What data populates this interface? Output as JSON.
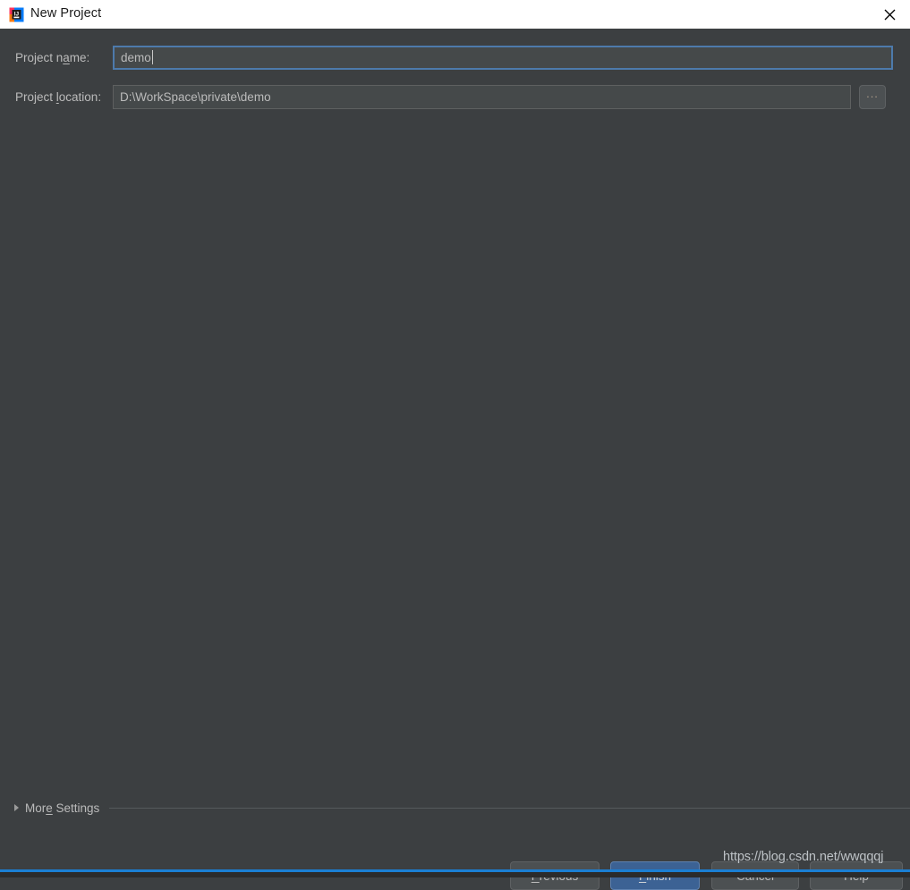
{
  "window": {
    "title": "New Project",
    "app_icon": "intellij-idea-icon",
    "close_icon": "close-icon",
    "accent_color": "#1b7fd3",
    "background_color": "#3c3f41",
    "titlebar_color": "#ffffff"
  },
  "form": {
    "project_name": {
      "label": "Project name:",
      "label_before_mnemonic": "Project n",
      "mnemonic": "a",
      "label_after_mnemonic": "me:",
      "value": "demo",
      "focused": true
    },
    "project_location": {
      "label": "Project location:",
      "label_before_mnemonic": "Project ",
      "mnemonic": "l",
      "label_after_mnemonic": "ocation:",
      "value": "D:\\WorkSpace\\private\\demo",
      "focused": false
    },
    "browse_button": {
      "label": "...",
      "icon": "ellipsis-icon"
    }
  },
  "more_settings": {
    "label": "More Settings",
    "label_before_mnemonic": "Mor",
    "mnemonic": "e",
    "label_after_mnemonic": " Settings",
    "expanded": false,
    "disclosure_icon": "triangle-right-icon"
  },
  "buttons": {
    "previous": {
      "label": "Previous",
      "label_before_mnemonic": "",
      "mnemonic": "P",
      "label_after_mnemonic": "revious",
      "default": false
    },
    "finish": {
      "label": "Finish",
      "label_before_mnemonic": "",
      "mnemonic": "F",
      "label_after_mnemonic": "inish",
      "default": true,
      "color": "#3c6294"
    },
    "cancel": {
      "label": "Cancel",
      "default": false
    },
    "help": {
      "label": "Help",
      "default": false
    }
  },
  "watermark": {
    "text": "https://blog.csdn.net/wwqqqj"
  }
}
